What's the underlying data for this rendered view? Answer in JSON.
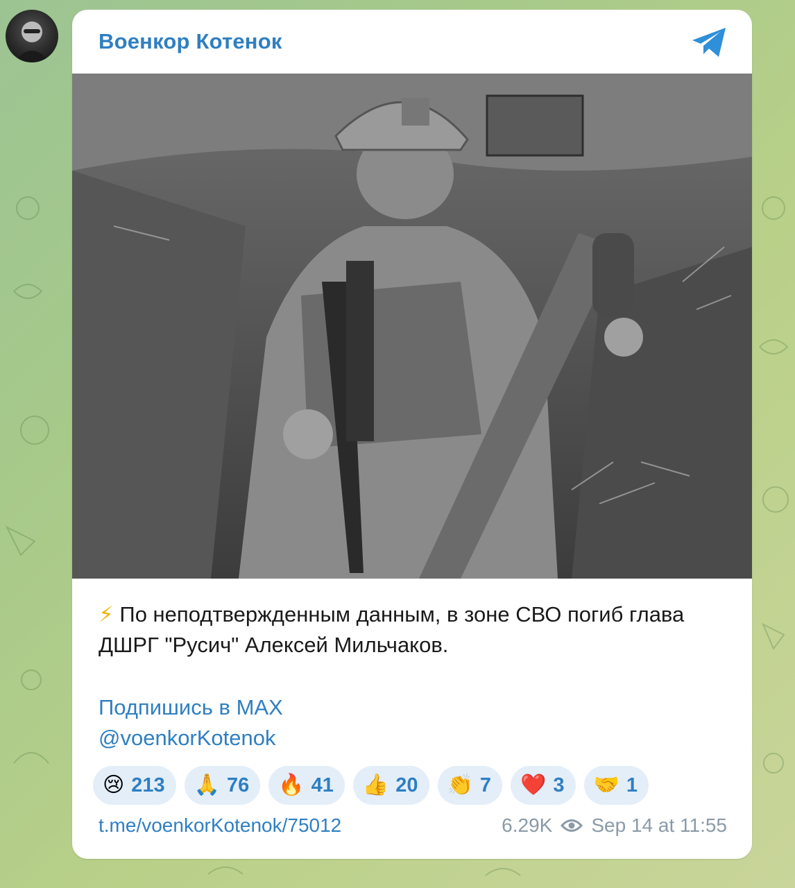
{
  "channel": {
    "name": "Военкор Котенок"
  },
  "post": {
    "lightning_emoji": "⚡",
    "text": "По неподтвержденным данным, в зоне СВО погиб глава ДШРГ \"Русич\" Алексей Мильчаков.",
    "link1": "Подпишись в MAX",
    "link2": "@voenkorKotenok",
    "url": "t.me/voenkorKotenok/75012",
    "views": "6.29K",
    "date": "Sep 14 at 11:55"
  },
  "reactions": [
    {
      "emoji": "😢",
      "count": "213"
    },
    {
      "emoji": "🙏",
      "count": "76"
    },
    {
      "emoji": "🔥",
      "count": "41"
    },
    {
      "emoji": "👍",
      "count": "20"
    },
    {
      "emoji": "👏",
      "count": "7"
    },
    {
      "emoji": "❤️",
      "count": "3"
    },
    {
      "emoji": "🤝",
      "count": "1"
    }
  ],
  "colors": {
    "accent": "#2f7fc1",
    "reaction_bg": "#e3eef9",
    "meta": "#8a9aa8"
  }
}
